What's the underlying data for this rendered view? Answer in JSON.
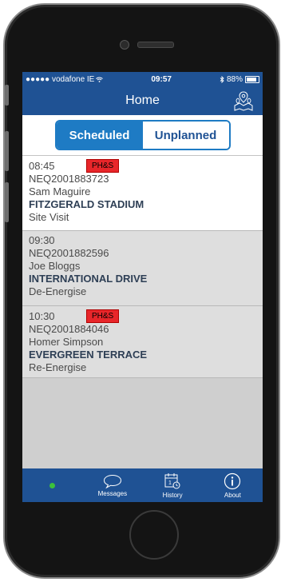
{
  "status_bar": {
    "carrier": "●●●●● vodafone IE",
    "time": "09:57",
    "battery": "88%"
  },
  "nav": {
    "title": "Home"
  },
  "segments": {
    "scheduled": "Scheduled",
    "unplanned": "Unplanned"
  },
  "jobs": [
    {
      "time": "08:45",
      "badge": "PH&S",
      "ref": "NEQ2001883723",
      "name": "Sam Maguire",
      "location": "FITZGERALD STADIUM",
      "type": "Site Visit"
    },
    {
      "time": "09:30",
      "badge": "",
      "ref": "NEQ2001882596",
      "name": "Joe Bloggs",
      "location": "INTERNATIONAL DRIVE",
      "type": "De-Energise"
    },
    {
      "time": "10:30",
      "badge": "PH&S",
      "ref": "NEQ2001884046",
      "name": "Homer Simpson",
      "location": "EVERGREEN TERRACE",
      "type": "Re-Energise"
    }
  ],
  "tabs": {
    "messages": "Messages",
    "history": "History",
    "about": "About"
  },
  "colors": {
    "brand": "#1f5294",
    "accent": "#1e7bc4",
    "badge": "#e8262a",
    "online": "#3cc13c"
  }
}
